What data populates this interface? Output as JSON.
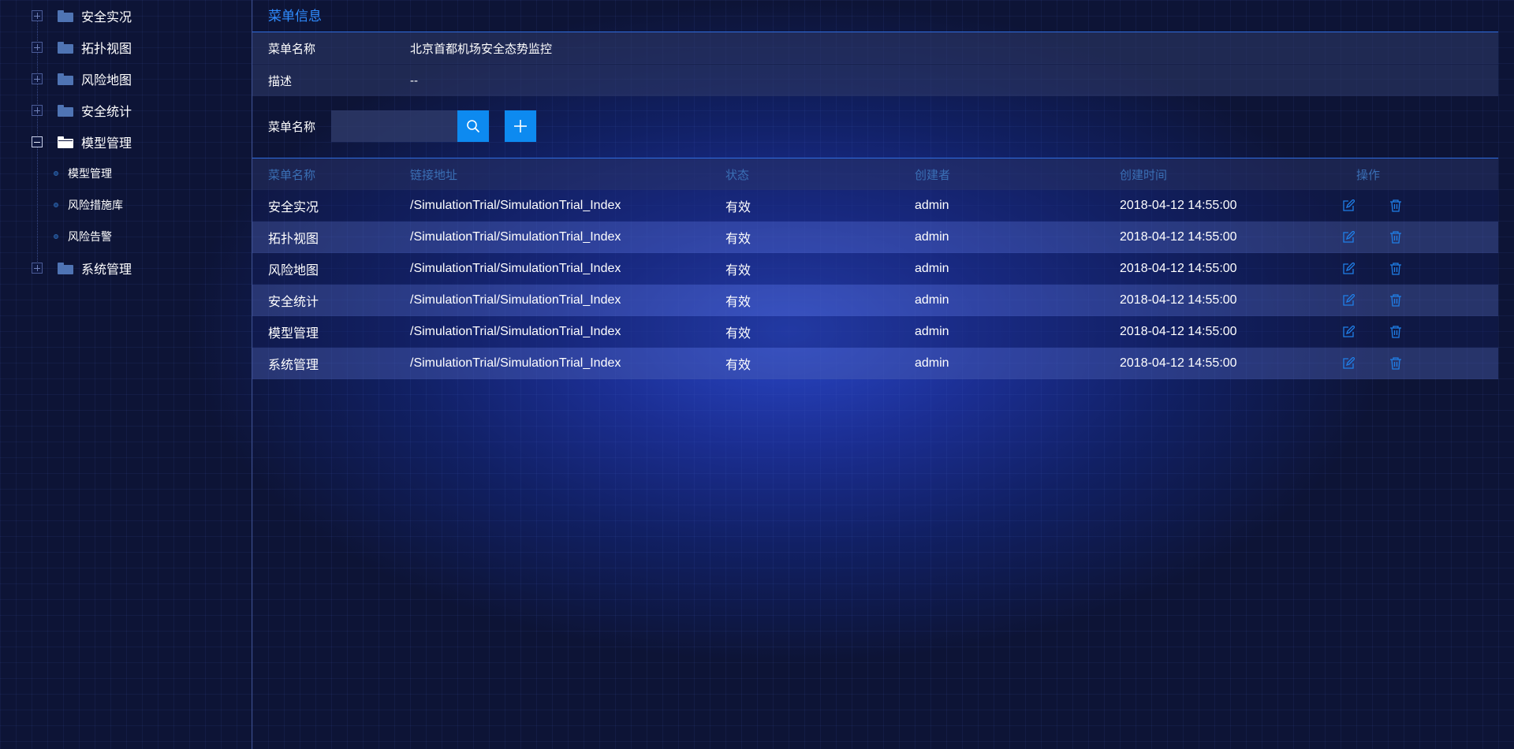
{
  "sidebar": {
    "nodes": [
      {
        "label": "安全实况",
        "state": "collapsed"
      },
      {
        "label": "拓扑视图",
        "state": "collapsed"
      },
      {
        "label": "风险地图",
        "state": "collapsed"
      },
      {
        "label": "安全统计",
        "state": "collapsed"
      },
      {
        "label": "模型管理",
        "state": "expanded"
      },
      {
        "label": "系统管理",
        "state": "collapsed"
      }
    ],
    "children": [
      {
        "label": "模型管理"
      },
      {
        "label": "风险措施库"
      },
      {
        "label": "风险告警"
      }
    ]
  },
  "main": {
    "section_title": "菜单信息",
    "info": {
      "name_label": "菜单名称",
      "name_value": "北京首都机场安全态势监控",
      "desc_label": "描述",
      "desc_value": "--"
    },
    "search": {
      "label": "菜单名称",
      "value": "",
      "search_icon": "search-icon",
      "add_icon": "plus-icon"
    },
    "table": {
      "headers": {
        "name": "菜单名称",
        "url": "链接地址",
        "status": "状态",
        "creator": "创建者",
        "created_at": "创建时间",
        "ops": "操作"
      },
      "rows": [
        {
          "name": "安全实况",
          "url": "/SimulationTrial/SimulationTrial_Index",
          "status": "有效",
          "creator": "admin",
          "created_at": "2018-04-12 14:55:00"
        },
        {
          "name": "拓扑视图",
          "url": "/SimulationTrial/SimulationTrial_Index",
          "status": "有效",
          "creator": "admin",
          "created_at": "2018-04-12 14:55:00"
        },
        {
          "name": "风险地图",
          "url": "/SimulationTrial/SimulationTrial_Index",
          "status": "有效",
          "creator": "admin",
          "created_at": "2018-04-12 14:55:00"
        },
        {
          "name": "安全统计",
          "url": "/SimulationTrial/SimulationTrial_Index",
          "status": "有效",
          "creator": "admin",
          "created_at": "2018-04-12 14:55:00"
        },
        {
          "name": "模型管理",
          "url": "/SimulationTrial/SimulationTrial_Index",
          "status": "有效",
          "creator": "admin",
          "created_at": "2018-04-12 14:55:00"
        },
        {
          "name": "系统管理",
          "url": "/SimulationTrial/SimulationTrial_Index",
          "status": "有效",
          "creator": "admin",
          "created_at": "2018-04-12 14:55:00"
        }
      ],
      "row_icons": {
        "edit": "edit-icon",
        "delete": "trash-icon"
      }
    }
  },
  "colors": {
    "accent": "#2f8cff",
    "button": "#0d8af0",
    "header_text": "#3a6fb5",
    "background": "#0d1436"
  }
}
